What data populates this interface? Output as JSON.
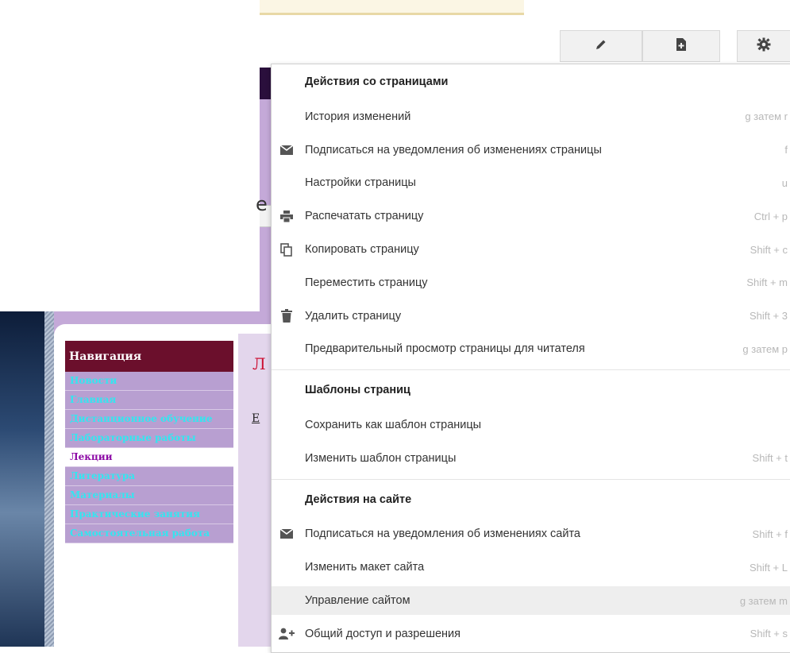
{
  "toolbar": {
    "buttons": [
      {
        "icon": "pencil-icon",
        "label": ""
      },
      {
        "icon": "new-page-icon",
        "label": ""
      },
      {
        "icon": "gear-icon",
        "label": ""
      }
    ]
  },
  "background": {
    "peek_letter": "е",
    "content_heading": "Л",
    "content_link": "Е"
  },
  "sidebar": {
    "title": "Навигация",
    "items": [
      {
        "label": "Новости",
        "active": false
      },
      {
        "label": "Главная",
        "active": false
      },
      {
        "label": "Дистанционное обучение",
        "active": false
      },
      {
        "label": "Лабораторные работы",
        "active": false
      },
      {
        "label": "Лекции",
        "active": true
      },
      {
        "label": "Литература",
        "active": false
      },
      {
        "label": "Материалы",
        "active": false
      },
      {
        "label": "Практические занятия",
        "active": false
      },
      {
        "label": "Самостоятельная работа",
        "active": false
      }
    ]
  },
  "menu": {
    "sections": [
      {
        "title": "Действия со страницами",
        "items": [
          {
            "label": "История изменений",
            "shortcut": "g затем r",
            "icon": ""
          },
          {
            "label": "Подписаться на уведомления об изменениях страницы",
            "shortcut": "f",
            "icon": "envelope-icon"
          },
          {
            "label": "Настройки страницы",
            "shortcut": "u",
            "icon": ""
          },
          {
            "label": "Распечатать страницу",
            "shortcut": "Ctrl + p",
            "icon": "printer-icon"
          },
          {
            "label": "Копировать страницу",
            "shortcut": "Shift + c",
            "icon": "copy-icon"
          },
          {
            "label": "Переместить страницу",
            "shortcut": "Shift + m",
            "icon": ""
          },
          {
            "label": "Удалить страницу",
            "shortcut": "Shift + 3",
            "icon": "trash-icon"
          },
          {
            "label": "Предварительный просмотр страницы для читателя",
            "shortcut": "g затем p",
            "icon": ""
          }
        ]
      },
      {
        "title": "Шаблоны страниц",
        "items": [
          {
            "label": "Сохранить как шаблон страницы",
            "shortcut": "",
            "icon": ""
          },
          {
            "label": "Изменить шаблон страницы",
            "shortcut": "Shift + t",
            "icon": ""
          }
        ]
      },
      {
        "title": "Действия на сайте",
        "items": [
          {
            "label": "Подписаться на уведомления об изменениях сайта",
            "shortcut": "Shift + f",
            "icon": "envelope-icon"
          },
          {
            "label": "Изменить макет сайта",
            "shortcut": "Shift + L",
            "icon": ""
          },
          {
            "label": "Управление сайтом",
            "shortcut": "g затем m",
            "icon": "",
            "highlighted": true
          },
          {
            "label": "Общий доступ и разрешения",
            "shortcut": "Shift + s",
            "icon": "add-person-icon"
          }
        ]
      }
    ]
  }
}
